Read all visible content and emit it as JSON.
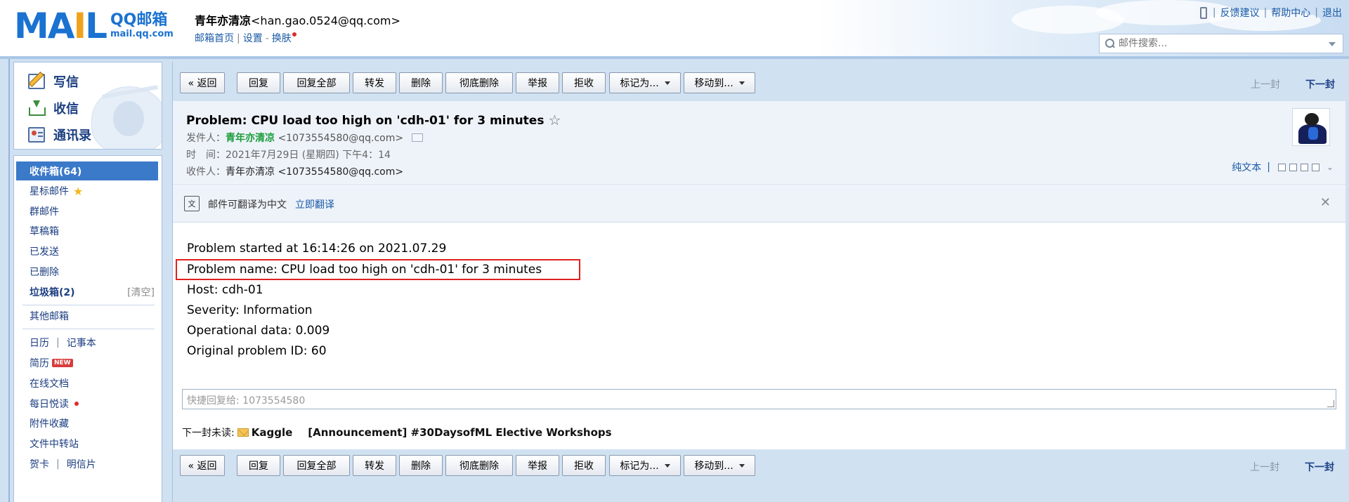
{
  "header": {
    "logo_mail": "MAIL",
    "logo_qq": "QQ邮箱",
    "logo_url": "mail.qq.com",
    "nickname": "青年亦清凉",
    "email": "<han.gao.0524@qq.com>",
    "links": [
      "邮箱首页",
      "设置",
      "换肤"
    ],
    "top_links": [
      "反馈建议",
      "帮助中心",
      "退出"
    ],
    "search_placeholder": "邮件搜索..."
  },
  "sidebar": {
    "actions": [
      {
        "label": "写信",
        "icon": "compose-icon"
      },
      {
        "label": "收信",
        "icon": "inbox-download-icon"
      },
      {
        "label": "通讯录",
        "icon": "contacts-icon"
      }
    ],
    "folders": [
      {
        "label": "收件箱(64)"
      },
      {
        "label": "星标邮件"
      },
      {
        "label": "群邮件"
      },
      {
        "label": "草稿箱"
      },
      {
        "label": "已发送"
      },
      {
        "label": "已删除"
      },
      {
        "label": "垃圾箱(2)",
        "extra": "[清空]"
      },
      {
        "label": "其他邮箱"
      },
      {
        "label": "日历",
        "label2": "记事本"
      },
      {
        "label": "简历",
        "badge": "NEW"
      },
      {
        "label": "在线文档"
      },
      {
        "label": "每日悦读"
      },
      {
        "label": "附件收藏"
      },
      {
        "label": "文件中转站"
      },
      {
        "label": "贺卡",
        "label2": "明信片"
      }
    ]
  },
  "toolbar": {
    "buttons": [
      "« 返回",
      "回复",
      "回复全部",
      "转发",
      "删除",
      "彻底删除",
      "举报",
      "拒收",
      "标记为...",
      "移动到..."
    ],
    "prev": "上一封",
    "next": "下一封"
  },
  "mail": {
    "subject": "Problem: CPU load too high on 'cdh-01' for 3 minutes",
    "star": "☆",
    "from_label": "发件人：",
    "from_name": "青年亦清凉",
    "from_addr": "<1073554580@qq.com>",
    "time_label": "时　间：",
    "time": "2021年7月29日 (星期四) 下午4：14",
    "to_label": "收件人：",
    "to": "青年亦清凉 <1073554580@qq.com>",
    "plain_text": "纯文本",
    "translate_text": "邮件可翻译为中文",
    "translate_link": "立即翻译",
    "body": [
      "Problem started at 16:14:26 on 2021.07.29",
      "Problem name: CPU load too high on 'cdh-01' for 3 minutes",
      "Host: cdh-01",
      "Severity: Information",
      "Operational data: 0.009",
      "Original problem ID: 60"
    ],
    "quick_reply_placeholder": "快捷回复给: 1073554580",
    "next_unread_label": "下一封未读:",
    "next_unread_sender": "Kaggle",
    "next_unread_subject": "[Announcement] #30DaysofML Elective Workshops"
  }
}
